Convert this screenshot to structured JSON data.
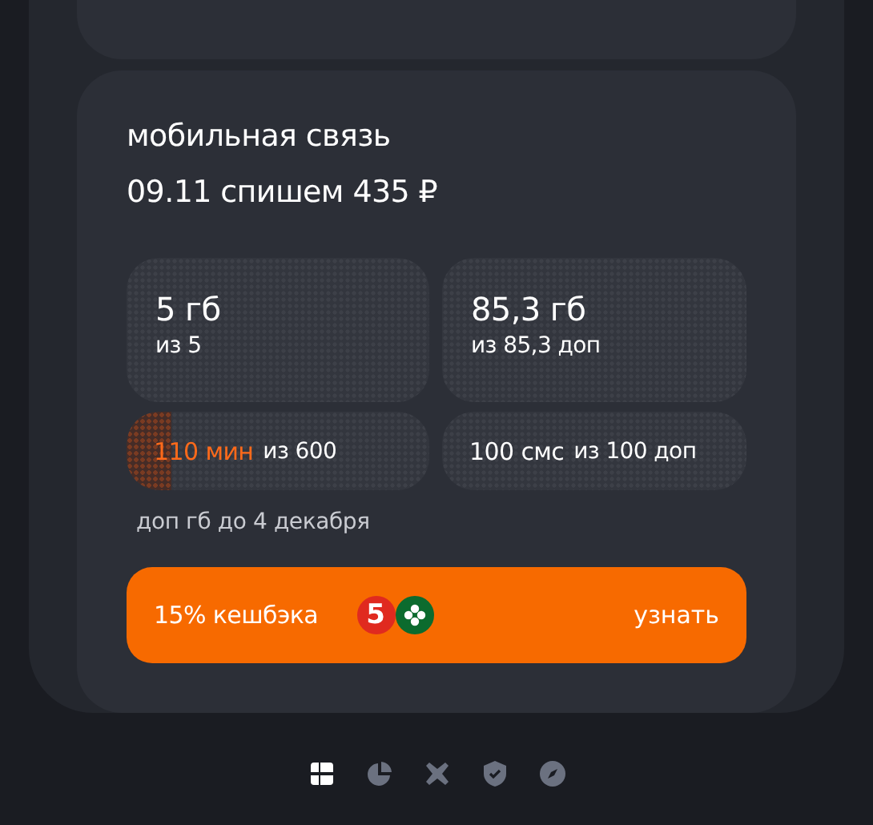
{
  "card": {
    "title": "мобильная связь",
    "subtitle": "09.11 спишем 435 ₽",
    "tiles": [
      {
        "kind": "big",
        "value": "5 гб",
        "caption": "из 5"
      },
      {
        "kind": "big",
        "value": "85,3 гб",
        "caption": "из 85,3 доп"
      },
      {
        "kind": "line",
        "value": "110 мин",
        "caption": "из 600",
        "accent": true,
        "level": 0.15
      },
      {
        "kind": "line",
        "value": "100 смс",
        "caption": "из 100 доп",
        "accent": false
      }
    ],
    "note": "доп гб до 4 декабря",
    "promo": {
      "label": "15% кешбэка",
      "logo_digit": "5",
      "action": "узнать"
    }
  },
  "nav": [
    {
      "kind": "grid",
      "selected": true
    },
    {
      "kind": "pie",
      "selected": false
    },
    {
      "kind": "cross",
      "selected": false
    },
    {
      "kind": "shield",
      "selected": false
    },
    {
      "kind": "compass",
      "selected": false
    }
  ]
}
